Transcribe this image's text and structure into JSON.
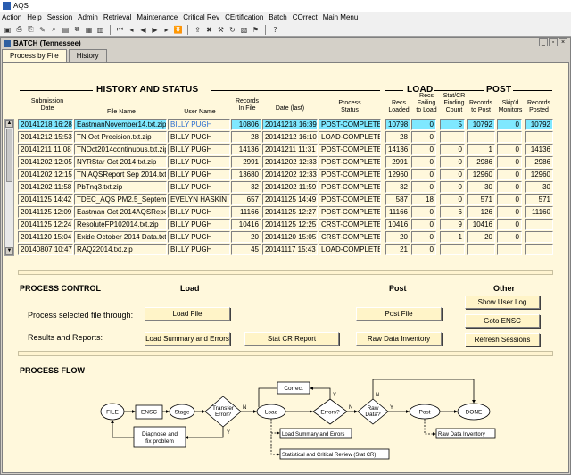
{
  "window": {
    "title": "AQS"
  },
  "menu": [
    "Action",
    "Help",
    "Session",
    "Admin",
    "Retrieval",
    "Maintenance",
    "Critical Rev",
    "CErtification",
    "Batch",
    "COrrect",
    "Main Menu"
  ],
  "toolbar_icons": [
    "save-icon",
    "print-icon",
    "bookmark-icon",
    "edit-icon",
    "find-icon",
    "doc-icon",
    "copy-icon",
    "paste-icon",
    "table-icon",
    "first-icon",
    "prev-icon",
    "back-icon",
    "next-icon",
    "last-icon",
    "down-icon",
    "upload-icon",
    "delete-icon",
    "tools-icon",
    "refresh-icon",
    "chart-icon",
    "flag-icon",
    "help-icon"
  ],
  "inner_title": "BATCH (Tennessee)",
  "tabs": [
    "Process by File",
    "History"
  ],
  "history": {
    "section_title": "HISTORY AND STATUS",
    "load_title": "LOAD",
    "post_title": "POST",
    "columns": {
      "sub_date": "Submission\nDate",
      "file_name": "File Name",
      "user": "User Name",
      "records_in_file": "Records\nIn File",
      "date_last": "Date (last)",
      "process_status": "Process\nStatus",
      "recs_loaded": "Recs\nLoaded",
      "recs_failing": "Recs\nFailing\nto Load",
      "statcr": "Stat/CR\nFinding\nCount",
      "records_to_post": "Records\nto Post",
      "skipd": "Skip'd\nMonitors",
      "records_posted": "Records\nPosted"
    },
    "rows": [
      {
        "sub": "20141218 16:28",
        "file": "EastmanNovember14.txt.zip",
        "user": "BILLY PUGH",
        "rif": "10806",
        "last": "20141218 16:39",
        "status": "POST-COMPLETED",
        "loaded": "10798",
        "failing": "0",
        "statcr": "5",
        "topost": "10792",
        "skipd": "0",
        "posted": "10792"
      },
      {
        "sub": "20141212 15:53",
        "file": "TN Oct Precision.txt.zip",
        "user": "BILLY PUGH",
        "rif": "28",
        "last": "20141212 16:10",
        "status": "LOAD-COMPLETED",
        "loaded": "28",
        "failing": "0",
        "statcr": "",
        "topost": "",
        "skipd": "",
        "posted": ""
      },
      {
        "sub": "20141211 11:08",
        "file": "TNOct2014continuous.txt.zip",
        "user": "BILLY PUGH",
        "rif": "14136",
        "last": "20141211 11:31",
        "status": "POST-COMPLETED",
        "loaded": "14136",
        "failing": "0",
        "statcr": "0",
        "topost": "1",
        "skipd": "0",
        "posted": "14136"
      },
      {
        "sub": "20141202 12:05",
        "file": "NYRStar Oct 2014.txt.zip",
        "user": "BILLY PUGH",
        "rif": "2991",
        "last": "20141202 12:33",
        "status": "POST-COMPLETED",
        "loaded": "2991",
        "failing": "0",
        "statcr": "0",
        "topost": "2986",
        "skipd": "0",
        "posted": "2986"
      },
      {
        "sub": "20141202 12:15",
        "file": "TN AQSReport Sep 2014.txt.",
        "user": "BILLY PUGH",
        "rif": "13680",
        "last": "20141202 12:33",
        "status": "POST-COMPLETED",
        "loaded": "12960",
        "failing": "0",
        "statcr": "0",
        "topost": "12960",
        "skipd": "0",
        "posted": "12960"
      },
      {
        "sub": "20141202 11:58",
        "file": "PbTnq3.txt.zip",
        "user": "BILLY PUGH",
        "rif": "32",
        "last": "20141202 11:59",
        "status": "POST-COMPLETED",
        "loaded": "32",
        "failing": "0",
        "statcr": "0",
        "topost": "30",
        "skipd": "0",
        "posted": "30"
      },
      {
        "sub": "20141125 14:42",
        "file": "TDEC_AQS PM2.5_Septemb",
        "user": "EVELYN HASKIN",
        "rif": "657",
        "last": "20141125 14:49",
        "status": "POST-COMPLETED",
        "loaded": "587",
        "failing": "18",
        "statcr": "0",
        "topost": "571",
        "skipd": "0",
        "posted": "571"
      },
      {
        "sub": "20141125 12:09",
        "file": "Eastman Oct 2014AQSRepo",
        "user": "BILLY PUGH",
        "rif": "11166",
        "last": "20141125 12:27",
        "status": "POST-COMPLETED",
        "loaded": "11166",
        "failing": "0",
        "statcr": "6",
        "topost": "126",
        "skipd": "0",
        "posted": "11160"
      },
      {
        "sub": "20141125 12:24",
        "file": "ResoluteFP102014.txt.zip",
        "user": "BILLY PUGH",
        "rif": "10416",
        "last": "20141125 12:25",
        "status": "CRST-COMPLETED",
        "loaded": "10416",
        "failing": "0",
        "statcr": "9",
        "topost": "10416",
        "skipd": "0",
        "posted": ""
      },
      {
        "sub": "20141120 15:04",
        "file": "Exide October 2014 Data.txt",
        "user": "BILLY PUGH",
        "rif": "20",
        "last": "20141120 15:05",
        "status": "CRST-COMPLETED",
        "loaded": "20",
        "failing": "0",
        "statcr": "1",
        "topost": "20",
        "skipd": "0",
        "posted": ""
      },
      {
        "sub": "20140807 10:47",
        "file": "RAQ22014.txt.zip",
        "user": "BILLY PUGH",
        "rif": "45",
        "last": "20141117 15:43",
        "status": "LOAD-COMPLETED",
        "loaded": "21",
        "failing": "0",
        "statcr": "",
        "topost": "",
        "skipd": "",
        "posted": ""
      }
    ]
  },
  "control": {
    "title": "PROCESS CONTROL",
    "load_head": "Load",
    "post_head": "Post",
    "other_head": "Other",
    "process_label": "Process selected file through:",
    "results_label": "Results and Reports:",
    "load_file": "Load File",
    "post_file": "Post File",
    "show_user_log": "Show User Log",
    "goto_ensc": "Goto ENSC",
    "load_summary": "Load Summary and Errors",
    "stat_cr": "Stat CR Report",
    "raw_inventory": "Raw Data Inventory",
    "refresh": "Refresh Sessions"
  },
  "flow": {
    "title": "PROCESS FLOW",
    "file": "FILE",
    "ensc": "ENSC",
    "stage": "Stage",
    "transfer": "Transfer\nError?",
    "load": "Load",
    "errors": "Errors?",
    "raw": "Raw\nData?",
    "post": "Post",
    "done": "DONE",
    "correct": "Correct",
    "diagnose": "Diagnose and\nfix problem",
    "load_summary": "Load Summary and Errors",
    "stat_review": "Statistical and Critical Review (Stat CR)",
    "raw_inventory": "Raw Data Inventory",
    "y": "Y",
    "n": "N"
  }
}
